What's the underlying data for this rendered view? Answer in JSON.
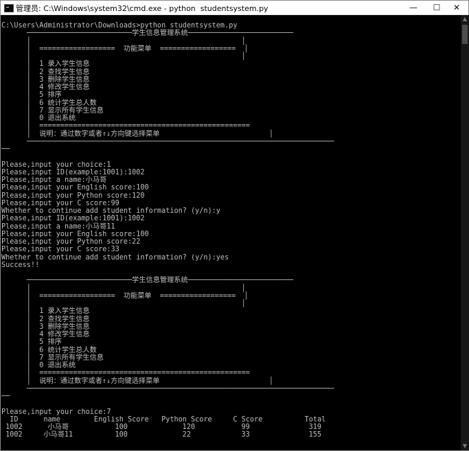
{
  "window": {
    "title": "管理员: C:\\Windows\\system32\\cmd.exe - python  studentsystem.py",
    "minimize_glyph": "—",
    "maximize_glyph": "☐",
    "close_glyph": "✕",
    "icon": "cmd-icon"
  },
  "scrollbar": {
    "up_glyph": "▲",
    "down_glyph": "▼"
  },
  "console": {
    "lines": [
      "C:\\Users\\Administrator\\Downloads>python studentsystem.py",
      "      ─────────────────────────学生信息管理系统─────────────────────────",
      "      │                                                  │",
      "      │  ==================  功能菜单  ==================  │",
      "      │                                                  │",
      "      │  1 录入学生信息",
      "      │  2 查找学生信息",
      "      │  3 删除学生信息",
      "      │  4 修改学生信息",
      "      │  5 排序",
      "      │  6 统计学生总人数",
      "      │  7 显示所有学生信息",
      "      │  0 退出系统",
      "      │  ==================================================",
      "      │  说明：通过数字或者↑↓方向键选择菜单                          │",
      "      ─────────────────────────────────────────────────────────────────────────",
      "──",
      "",
      "Please,input your choice:1",
      "Please,input ID(example:1001):1002",
      "Please,input a name:小马哥",
      "Please,input your English score:100",
      "Please,input your Python score:120",
      "Please,input your C score:99",
      "Whether to continue add student information? (y/n):y",
      "Please,input ID(example:1001):1002",
      "Please,input a name:小马哥11",
      "Please,input your English score:100",
      "Please,input your Python score:22",
      "Please,input your C score:33",
      "Whether to continue add student information? (y/n):yes",
      "Success!!",
      "",
      "      ─────────────────────────学生信息管理系统─────────────────────────",
      "      │                                                  │",
      "      │  ==================  功能菜单  ==================  │",
      "      │                                                  │",
      "      │  1 录入学生信息",
      "      │  2 查找学生信息",
      "      │  3 删除学生信息",
      "      │  4 修改学生信息",
      "      │  5 排序",
      "      │  6 统计学生总人数",
      "      │  7 显示所有学生信息",
      "      │  0 退出系统",
      "      │  ==================================================",
      "      │  说明：通过数字或者↑↓方向键选择菜单                          │",
      "      ─────────────────────────────────────────────────────────────────────────",
      "──",
      "",
      "Please,input your choice:7",
      "  ID      name        English Score   Python Score     C Score          Total",
      " 1002      小马哥           100             120           99              319",
      " 1002     小马哥11          100             22            33              155"
    ]
  }
}
